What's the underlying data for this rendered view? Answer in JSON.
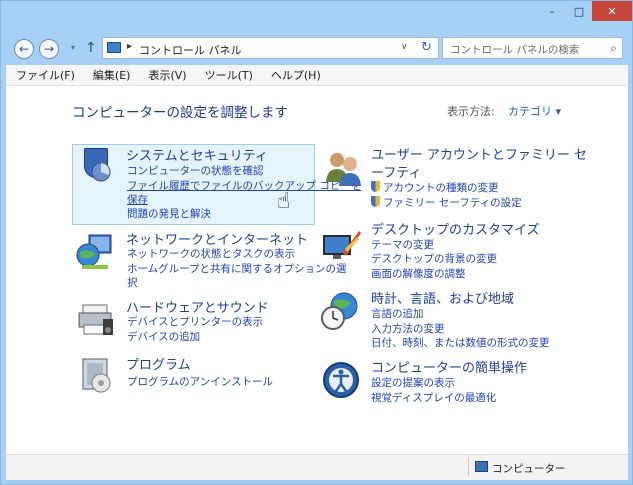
{
  "window": {
    "controls": {
      "minimize": "–",
      "maximize": "□",
      "close": "✕"
    }
  },
  "nav": {
    "back_icon": "←",
    "forward_icon": "→",
    "dropdown_icon": "▾",
    "up_icon": "↑",
    "address_sep": "▸",
    "address_path": "コントロール パネル",
    "address_dropdown": "∨",
    "refresh_icon": "↻",
    "search_placeholder": "コントロール パネルの検索",
    "search_icon": "⌕"
  },
  "menu": [
    "ファイル(F)",
    "編集(E)",
    "表示(V)",
    "ツール(T)",
    "ヘルプ(H)"
  ],
  "header": {
    "title": "コンピューターの設定を調整します",
    "view_by_label": "表示方法:",
    "view_by_value": "カテゴリ ▾"
  },
  "categories": {
    "system": {
      "title": "システムとセキュリティ",
      "links": [
        "コンピューターの状態を確認",
        "ファイル履歴でファイルのバックアップ コピーを",
        "保存",
        "問題の発見と解決"
      ]
    },
    "network": {
      "title": "ネットワークとインターネット",
      "links": [
        "ネットワークの状態とタスクの表示",
        "ホームグループと共有に関するオプションの選",
        "択"
      ]
    },
    "hardware": {
      "title": "ハードウェアとサウンド",
      "links": [
        "デバイスとプリンターの表示",
        "デバイスの追加"
      ]
    },
    "programs": {
      "title": "プログラム",
      "links": [
        "プログラムのアンインストール"
      ]
    },
    "users": {
      "title_line1": "ユーザー アカウントとファミリー セ",
      "title_line2": "ーフティ",
      "links": [
        "アカウントの種類の変更",
        "ファミリー セーフティの設定"
      ]
    },
    "appearance": {
      "title": "デスクトップのカスタマイズ",
      "links": [
        "テーマの変更",
        "デスクトップの背景の変更",
        "画面の解像度の調整"
      ]
    },
    "clock": {
      "title": "時計、言語、および地域",
      "links": [
        "言語の追加",
        "入力方法の変更",
        "日付、時刻、または数値の形式の変更"
      ]
    },
    "ease": {
      "title": "コンピューターの簡単操作",
      "links": [
        "設定の提案の表示",
        "視覚ディスプレイの最適化"
      ]
    }
  },
  "status": {
    "text": "コンピューター"
  },
  "colors": {
    "accent": "#1f3e9a",
    "link": "#1f45b8",
    "frame": "#a7d0f7",
    "close": "#c7463b"
  }
}
